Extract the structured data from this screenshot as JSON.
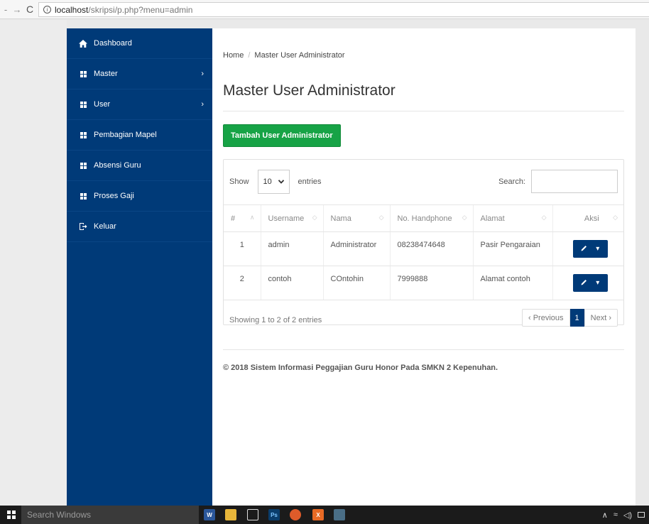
{
  "browser": {
    "url_host": "localhost",
    "url_path": "/skripsi/p.php?menu=admin"
  },
  "sidebar": {
    "items": [
      {
        "label": "Dashboard",
        "icon": "home-icon"
      },
      {
        "label": "Master",
        "icon": "grid-icon",
        "has_submenu": true
      },
      {
        "label": "User",
        "icon": "grid-icon",
        "has_submenu": true
      },
      {
        "label": "Pembagian Mapel",
        "icon": "grid-icon"
      },
      {
        "label": "Absensi Guru",
        "icon": "grid-icon"
      },
      {
        "label": "Proses Gaji",
        "icon": "grid-icon"
      },
      {
        "label": "Keluar",
        "icon": "logout-icon"
      }
    ]
  },
  "breadcrumb": {
    "home": "Home",
    "separator": "/",
    "current": "Master User Administrator"
  },
  "page": {
    "title": "Master User Administrator",
    "add_button": "Tambah User Administrator"
  },
  "table_controls": {
    "show_label": "Show",
    "entries_value": "10",
    "entries_label": "entries",
    "search_label": "Search:",
    "search_value": ""
  },
  "table": {
    "columns": [
      "#",
      "Username",
      "Nama",
      "No. Handphone",
      "Alamat",
      "Aksi"
    ],
    "rows": [
      {
        "no": "1",
        "username": "admin",
        "nama": "Administrator",
        "hp": "08238474648",
        "alamat": "Pasir Pengaraian"
      },
      {
        "no": "2",
        "username": "contoh",
        "nama": "COntohin",
        "hp": "7999888",
        "alamat": "Alamat contoh"
      }
    ]
  },
  "pagination": {
    "info": "Showing 1 to 2 of 2 entries",
    "previous": "‹ Previous",
    "current_page": "1",
    "next": "Next ›"
  },
  "footer": {
    "text": "© 2018 Sistem Informasi Peggajian Guru Honor Pada SMKN 2 Kepenuhan."
  },
  "taskbar": {
    "search_placeholder": "Search Windows"
  },
  "colors": {
    "sidebar_bg": "#003a78",
    "primary": "#003a78",
    "success": "#17a346"
  }
}
